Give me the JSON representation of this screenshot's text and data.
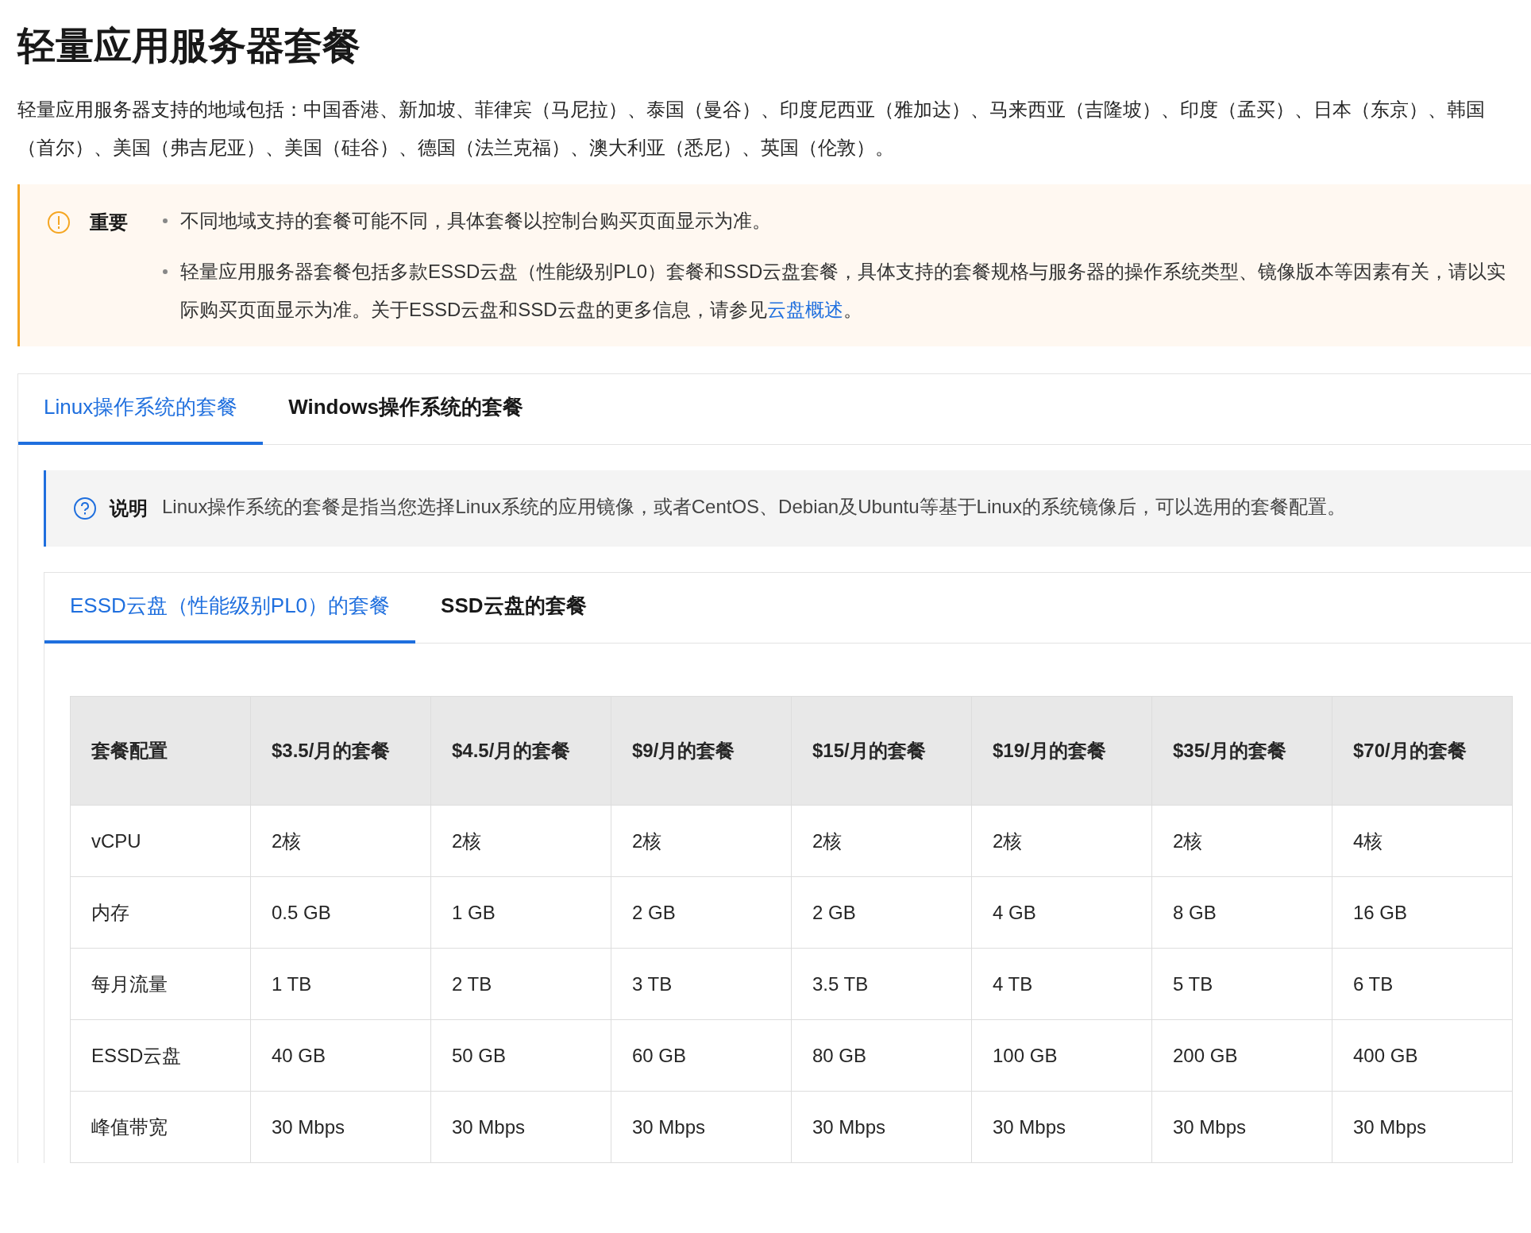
{
  "title": "轻量应用服务器套餐",
  "intro": "轻量应用服务器支持的地域包括：中国香港、新加坡、菲律宾（马尼拉）、泰国（曼谷）、印度尼西亚（雅加达）、马来西亚（吉隆坡）、印度（孟买）、日本（东京）、韩国（首尔）、美国（弗吉尼亚）、美国（硅谷）、德国（法兰克福）、澳大利亚（悉尼）、英国（伦敦）。",
  "notice": {
    "label": "重要",
    "items": [
      {
        "text": "不同地域支持的套餐可能不同，具体套餐以控制台购买页面显示为准。"
      },
      {
        "text": "轻量应用服务器套餐包括多款ESSD云盘（性能级别PL0）套餐和SSD云盘套餐，具体支持的套餐规格与服务器的操作系统类型、镜像版本等因素有关，请以实际购买页面显示为准。关于ESSD云盘和SSD云盘的更多信息，请参见",
        "link": "云盘概述",
        "after": "。"
      }
    ]
  },
  "os_tabs": [
    {
      "label": "Linux操作系统的套餐",
      "selected": true
    },
    {
      "label": "Windows操作系统的套餐",
      "selected": false
    }
  ],
  "note": {
    "label": "说明",
    "text": "Linux操作系统的套餐是指当您选择Linux系统的应用镜像，或者CentOS、Debian及Ubuntu等基于Linux的系统镜像后，可以选用的套餐配置。"
  },
  "disk_tabs": [
    {
      "label": "ESSD云盘（性能级别PL0）的套餐",
      "selected": true
    },
    {
      "label": "SSD云盘的套餐",
      "selected": false
    }
  ],
  "table": {
    "columns": [
      "套餐配置",
      "$3.5/月的套餐",
      "$4.5/月的套餐",
      "$9/月的套餐",
      "$15/月的套餐",
      "$19/月的套餐",
      "$35/月的套餐",
      "$70/月的套餐"
    ],
    "rows": [
      [
        "vCPU",
        "2核",
        "2核",
        "2核",
        "2核",
        "2核",
        "2核",
        "4核"
      ],
      [
        "内存",
        "0.5 GB",
        "1 GB",
        "2 GB",
        "2 GB",
        "4 GB",
        "8 GB",
        "16 GB"
      ],
      [
        "每月流量",
        "1 TB",
        "2 TB",
        "3 TB",
        "3.5 TB",
        "4 TB",
        "5 TB",
        "6 TB"
      ],
      [
        "ESSD云盘",
        "40 GB",
        "50 GB",
        "60 GB",
        "80 GB",
        "100 GB",
        "200 GB",
        "400 GB"
      ],
      [
        "峰值带宽",
        "30 Mbps",
        "30 Mbps",
        "30 Mbps",
        "30 Mbps",
        "30 Mbps",
        "30 Mbps",
        "30 Mbps"
      ]
    ]
  }
}
